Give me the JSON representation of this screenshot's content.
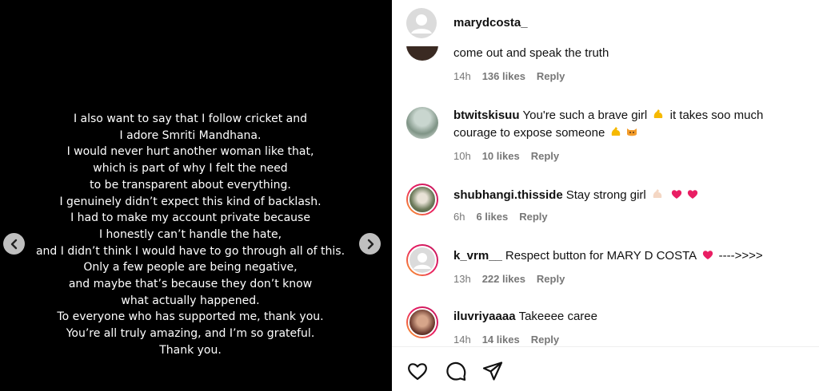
{
  "media": {
    "lines": [
      "I also want to say that I follow cricket and",
      "I adore Smriti Mandhana.",
      "I would never hurt another woman like that,",
      "which is part of why I felt the need",
      "to be transparent about everything.",
      "I genuinely didn’t expect this kind of backlash.",
      "I had to make my account private because",
      "I honestly can’t handle the hate,",
      "and I didn’t think I would have to go through all of this.",
      "Only a few people are being negative,",
      "and maybe that’s because they don’t know",
      "what actually happened.",
      "To everyone who has supported me, thank you.",
      "You’re all truly amazing, and I’m so grateful.",
      "Thank you."
    ],
    "prev_icon": "chevron-left-icon",
    "next_icon": "chevron-right-icon"
  },
  "header": {
    "username": "marydcosta_"
  },
  "comments": [
    {
      "user": "",
      "text": "come out and speak the truth",
      "time": "14h",
      "likes": "136 likes",
      "reply": "Reply"
    },
    {
      "user": "btwitskisuu",
      "text": "You're such a brave girl",
      "text2": "it takes soo much courage to expose someone",
      "time": "10h",
      "likes": "10 likes",
      "reply": "Reply"
    },
    {
      "user": "shubhangi.thisside",
      "text": "Stay strong girl",
      "time": "6h",
      "likes": "6 likes",
      "reply": "Reply"
    },
    {
      "user": "k_vrm__",
      "text": "Respect button for MARY D COSTA",
      "text2": "---->>>>",
      "time": "13h",
      "likes": "222 likes",
      "reply": "Reply"
    },
    {
      "user": "iluvriyaaaa",
      "text": "Takeeee caree",
      "time": "14h",
      "likes": "14 likes",
      "reply": "Reply"
    }
  ],
  "footer": {
    "icons": [
      "heart-icon",
      "comment-icon",
      "share-icon"
    ]
  },
  "colors": {
    "media_bg": "#000000",
    "heart": "#ed1b4f",
    "muted": "#777777"
  }
}
